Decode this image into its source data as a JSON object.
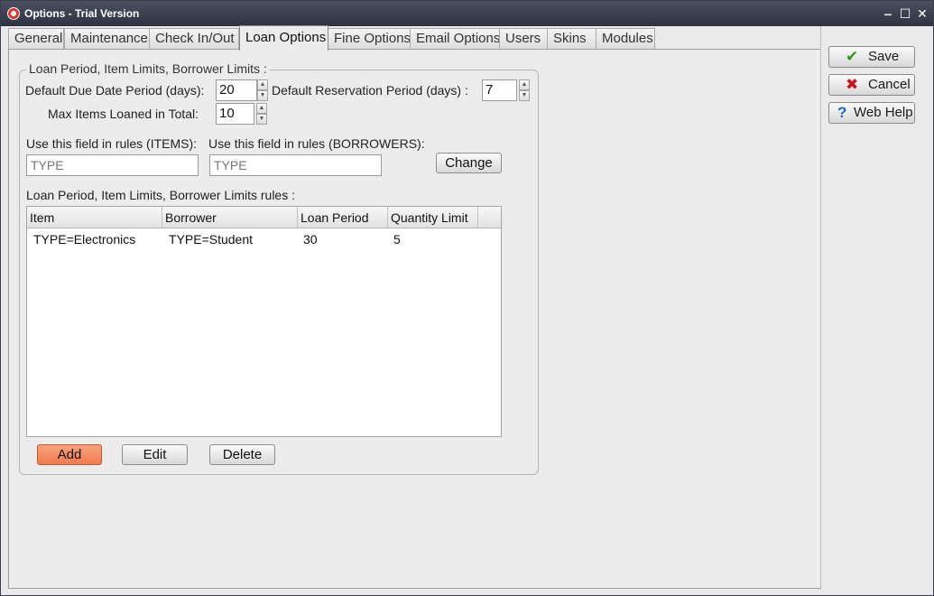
{
  "window": {
    "title": "Options - Trial Version",
    "controls": {
      "minimize": "‒",
      "maximize": "☐",
      "close": "✕"
    }
  },
  "tabs": [
    {
      "label": "General"
    },
    {
      "label": "Maintenance"
    },
    {
      "label": "Check In/Out"
    },
    {
      "label": "Loan Options",
      "active": true
    },
    {
      "label": "Fine Options"
    },
    {
      "label": "Email Options"
    },
    {
      "label": "Users"
    },
    {
      "label": "Skins"
    },
    {
      "label": "Modules"
    }
  ],
  "loan_group": {
    "legend": "Loan Period, Item Limits, Borrower Limits :",
    "due_date_label": "Default Due Date Period (days):",
    "due_date_value": "20",
    "reservation_label": "Default Reservation Period (days) :",
    "reservation_value": "7",
    "max_items_label": "Max Items Loaned in Total:",
    "max_items_value": "10",
    "items_field_label": "Use this field in rules (ITEMS):",
    "items_field_value": "TYPE",
    "borrowers_field_label": "Use this field in rules (BORROWERS):",
    "borrowers_field_value": "TYPE",
    "change_button": "Change",
    "rules_label": "Loan Period, Item Limits, Borrower Limits rules :"
  },
  "rules_table": {
    "columns": [
      "Item",
      "Borrower",
      "Loan Period",
      "Quantity Limit"
    ],
    "rows": [
      [
        "TYPE=Electronics",
        "TYPE=Student",
        "30",
        "5"
      ]
    ]
  },
  "rule_buttons": {
    "add": "Add",
    "edit": "Edit",
    "delete": "Delete"
  },
  "side_buttons": {
    "save": "Save",
    "cancel": "Cancel",
    "help": "Web Help"
  },
  "colors": {
    "accent_add": "#ef7b4f",
    "save_check": "#2e9a1c",
    "cancel_x": "#c9141b",
    "help_q": "#1f67c9"
  }
}
